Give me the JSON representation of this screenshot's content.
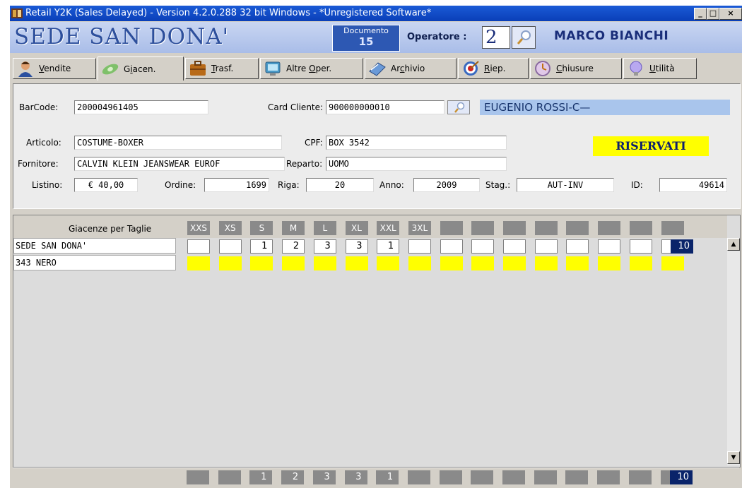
{
  "window": {
    "title": "Retail Y2K (Sales Delayed)  - Version 4.2.0.288  32 bit Windows - *Unregistered Software*",
    "controls": [
      "_",
      "□",
      "×"
    ]
  },
  "header": {
    "store_name": "SEDE SAN DONA'",
    "documento_label": "Documento",
    "documento_number": "15",
    "operatore_label": "Operatore :",
    "operatore_number": "2",
    "operatore_name": "MARCO BIANCHI"
  },
  "tabs": [
    {
      "label": "Vendite",
      "icon": "user-icon",
      "active": false
    },
    {
      "label": "Giacen.",
      "icon": "money-icon",
      "active": true
    },
    {
      "label": "Trasf.",
      "icon": "briefcase-icon",
      "active": false
    },
    {
      "label": "Altre Oper.",
      "icon": "monitor-icon",
      "active": false
    },
    {
      "label": "Archivio",
      "icon": "books-icon",
      "active": false
    },
    {
      "label": "Riep.",
      "icon": "target-icon",
      "active": false
    },
    {
      "label": "Chiusure",
      "icon": "clock-icon",
      "active": false
    },
    {
      "label": "Utilità",
      "icon": "lightbulb-icon",
      "active": false
    }
  ],
  "form": {
    "barcode_label": "BarCode:",
    "barcode": "200004961405",
    "card_label": "Card Cliente:",
    "card": "900000000010",
    "customer_name": "EUGENIO ROSSI-C—",
    "articolo_label": "Articolo:",
    "articolo": "COSTUME-BOXER",
    "cpf_label": "CPF:",
    "cpf": "BOX 3542",
    "riservati": "RISERVATI",
    "fornitore_label": "Fornitore:",
    "fornitore": "CALVIN KLEIN JEANSWEAR EUROF",
    "reparto_label": "Reparto:",
    "reparto": "UOMO",
    "listino_label": "Listino:",
    "listino": "€ 40,00",
    "ordine_label": "Ordine:",
    "ordine": "1699",
    "riga_label": "Riga:",
    "riga": "20",
    "anno_label": "Anno:",
    "anno": "2009",
    "stag_label": "Stag.:",
    "stag": "AUT-INV",
    "id_label": "ID:",
    "id": "49614"
  },
  "grid": {
    "header_label": "Giacenze per Taglie",
    "sizes": [
      "XXS",
      "XS",
      "S",
      "M",
      "L",
      "XL",
      "XXL",
      "3XL",
      "",
      "",
      "",
      "",
      "",
      "",
      "",
      ""
    ],
    "rows": [
      {
        "name": "SEDE SAN DONA'",
        "values": [
          "",
          "",
          "1",
          "2",
          "3",
          "3",
          "1",
          "",
          "",
          "",
          "",
          "",
          "",
          "",
          "",
          ""
        ],
        "total": "10"
      },
      {
        "name": "343 NERO"
      }
    ],
    "footer_values": [
      "",
      "",
      "1",
      "2",
      "3",
      "3",
      "1",
      "",
      "",
      "",
      "",
      "",
      "",
      "",
      "",
      ""
    ],
    "footer_total": "10"
  },
  "colors": {
    "title_bar": "#0a3fb8",
    "header_bg": "#a9bde8",
    "customer_bg": "#a9c5ec",
    "riservati_bg": "#ffff00",
    "total_bg": "#0a246a"
  }
}
